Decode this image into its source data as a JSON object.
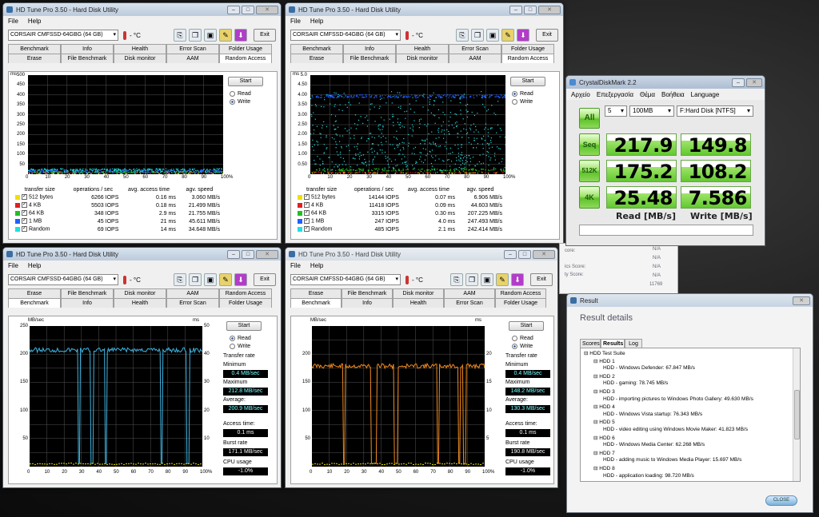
{
  "hdt_title": "HD Tune Pro 3.50 - Hard Disk Utility",
  "menu": {
    "file": "File",
    "help": "Help"
  },
  "drive": "CORSAIR CMFSSD-64GBG (64 GB)",
  "temp": "- °C",
  "exit": "Exit",
  "start": "Start",
  "read": "Read",
  "write": "Write",
  "tabs_top": [
    "Benchmark",
    "Info",
    "Health",
    "Error Scan",
    "Folder Usage"
  ],
  "tabs_bottom": [
    "Erase",
    "File Benchmark",
    "Disk monitor",
    "AAM",
    "Random Access"
  ],
  "tabs_bench_top": [
    "Erase",
    "File Benchmark",
    "Disk monitor",
    "AAM",
    "Random Access"
  ],
  "tabs_bench_bottom": [
    "Benchmark",
    "Info",
    "Health",
    "Error Scan",
    "Folder Usage"
  ],
  "ra_headers": [
    "transfer size",
    "operations / sec",
    "avg. access time",
    "agv. speed"
  ],
  "ra1": {
    "yunit": "ms",
    "yticks": [
      "500",
      "450",
      "400",
      "350",
      "300",
      "250",
      "200",
      "150",
      "100",
      "50"
    ],
    "rows": [
      [
        "512 bytes",
        "6266 IOPS",
        "0.16 ms",
        "3.060 MB/s"
      ],
      [
        "4 KB",
        "5503 IOPS",
        "0.18 ms",
        "21.499 MB/s"
      ],
      [
        "64 KB",
        "348 IOPS",
        "2.9 ms",
        "21.755 MB/s"
      ],
      [
        "1 MB",
        "45 IOPS",
        "21 ms",
        "45.611 MB/s"
      ],
      [
        "Random",
        "69 IOPS",
        "14 ms",
        "34.648 MB/s"
      ]
    ]
  },
  "ra2": {
    "yunit": "ms",
    "yticks": [
      "5.0",
      "4.50",
      "4.00",
      "3.50",
      "3.00",
      "2.50",
      "2.00",
      "1.50",
      "1.00",
      "0.50"
    ],
    "rows": [
      [
        "512 bytes",
        "14144 IOPS",
        "0.07 ms",
        "6.906 MB/s"
      ],
      [
        "4 KB",
        "11418 IOPS",
        "0.09 ms",
        "44.603 MB/s"
      ],
      [
        "64 KB",
        "3315 IOPS",
        "0.30 ms",
        "207.225 MB/s"
      ],
      [
        "1 MB",
        "247 IOPS",
        "4.0 ms",
        "247.493 MB/s"
      ],
      [
        "Random",
        "485 IOPS",
        "2.1 ms",
        "242.414 MB/s"
      ]
    ]
  },
  "xticks": [
    "0",
    "10",
    "20",
    "30",
    "40",
    "50",
    "60",
    "70",
    "80",
    "90",
    "100%"
  ],
  "bench_labels": {
    "unit_l": "MB/sec",
    "unit_r": "ms",
    "transfer": "Transfer rate",
    "minimum": "Minimum",
    "maximum": "Maximum",
    "average": "Average:",
    "access": "Access time:",
    "burst": "Burst rate",
    "cpu": "CPU usage"
  },
  "b1": {
    "ylticks": [
      "250",
      "200",
      "150",
      "100",
      "50"
    ],
    "yrticks": [
      "50",
      "40",
      "30",
      "20",
      "10"
    ],
    "min": "0.4 MB/sec",
    "max": "212.8 MB/sec",
    "avg": "200.9 MB/sec",
    "access": "0.1 ms",
    "burst": "171.1 MB/sec",
    "cpu": "-1.0%"
  },
  "b2": {
    "ylticks": [
      "200",
      "150",
      "100",
      "50"
    ],
    "yrticks": [
      "20",
      "15",
      "10",
      "5"
    ],
    "min": "0.4 MB/sec",
    "max": "148.2 MB/sec",
    "avg": "130.3 MB/sec",
    "access": "0.1 ms",
    "burst": "190.8 MB/sec",
    "cpu": "-1.0%"
  },
  "cdm": {
    "title": "CrystalDiskMark 2.2",
    "menu": [
      "Αρχείο",
      "Επεξεργασία",
      "Θέμα",
      "Βοήθεια",
      "Language"
    ],
    "count": "5",
    "size": "100MB",
    "drive": "F:Hard Disk [NTFS]",
    "all": "All",
    "rows": [
      {
        "label": "Seq",
        "read": "217.9",
        "write": "149.8"
      },
      {
        "label": "512K",
        "read": "175.2",
        "write": "108.2"
      },
      {
        "label": "4K",
        "read": "25.48",
        "write": "7.586"
      }
    ],
    "read_label": "Read [MB/s]",
    "write_label": "Write [MB/s]"
  },
  "ws": {
    "lines": [
      "core:",
      "ics Score:",
      "ty Score:"
    ],
    "vals": [
      "N/A",
      "N/A",
      "N/A",
      "N/A",
      "11769"
    ]
  },
  "result": {
    "title": "Result",
    "heading": "Result details",
    "tabs": [
      "Scores",
      "Results",
      "Log"
    ],
    "tree": [
      "HDD Test Suite",
      "HDD 1",
      "HDD - Windows Defender: 67.847 MB/s",
      "HDD 2",
      "HDD - gaming: 78.745 MB/s",
      "HDD 3",
      "HDD - importing pictures to Windows Photo Gallery: 49.630 MB/s",
      "HDD 4",
      "HDD - Windows Vista startup: 76.343 MB/s",
      "HDD 5",
      "HDD - video editing using Windows Movie Maker: 41.823 MB/s",
      "HDD 6",
      "HDD - Windows Media Center: 62.268 MB/s",
      "HDD 7",
      "HDD - adding music to Windows Media Player: 15.697 MB/s",
      "HDD 8",
      "HDD - application loading: 98.720 MB/s"
    ],
    "close": "CLOSE"
  },
  "colors": {
    "s512": "#f0e000",
    "s4k": "#e02020",
    "s64k": "#20c020",
    "s1m": "#2060ff",
    "srand": "#20e0e0",
    "bench_read": "#3fb3e0",
    "bench_write": "#f08a20"
  }
}
